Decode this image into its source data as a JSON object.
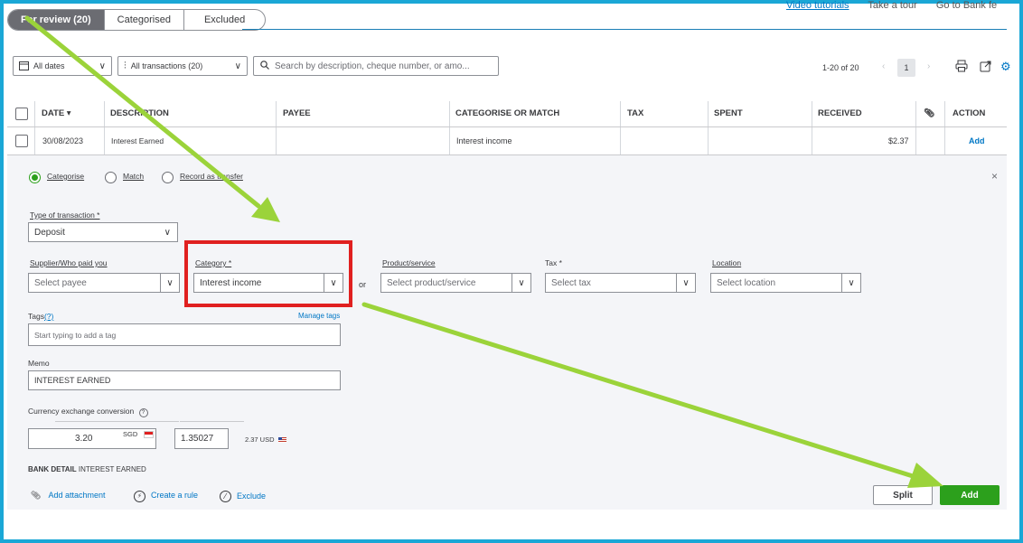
{
  "top_links": {
    "video": "Video tutorials",
    "tour": "Take a tour",
    "goto": "Go to Bank fe"
  },
  "tabs": [
    {
      "label": "For review (20)",
      "active": true
    },
    {
      "label": "Categorised",
      "active": false
    },
    {
      "label": "Excluded",
      "active": false
    }
  ],
  "filters": {
    "dates": "All dates",
    "transactions": "All transactions (20)",
    "search_placeholder": "Search by description, cheque number, or amo..."
  },
  "pager": {
    "range": "1-20 of 20",
    "page": "1"
  },
  "table": {
    "headers": {
      "date": "DATE",
      "description": "DESCRIPTION",
      "payee": "PAYEE",
      "category": "CATEGORISE OR MATCH",
      "tax": "TAX",
      "spent": "SPENT",
      "received": "RECEIVED",
      "action": "ACTION"
    },
    "row": {
      "date": "30/08/2023",
      "description": "Interest Earned",
      "payee": "",
      "category": "Interest income",
      "tax": "",
      "spent": "",
      "received": "$2.37",
      "action": "Add"
    }
  },
  "panel": {
    "modes": {
      "categorise": "Categorise",
      "match": "Match",
      "transfer": "Record as transfer"
    },
    "type_label": "Type of transaction *",
    "type_value": "Deposit",
    "supplier_label": "Supplier/Who paid you",
    "supplier_placeholder": "Select payee",
    "category_label": "Category *",
    "category_value": "Interest income",
    "or_text": "or",
    "product_label": "Product/service",
    "product_placeholder": "Select product/service",
    "tax_label": "Tax *",
    "tax_placeholder": "Select tax",
    "location_label": "Location",
    "location_placeholder": "Select location",
    "tags_label": "Tags",
    "tags_help": "(?)",
    "manage_tags": "Manage tags",
    "tags_placeholder": "Start typing to add a tag",
    "memo_label": "Memo",
    "memo_value": "INTEREST EARNED",
    "currency_label": "Currency exchange conversion",
    "amount_value": "3.20",
    "currency_code": "SGD",
    "rate_value": "1.35027",
    "converted_value": "2.37 USD",
    "bank_detail_label": "BANK DETAIL",
    "bank_detail_value": "INTEREST EARNED",
    "add_attachment": "Add attachment",
    "create_rule": "Create a rule",
    "exclude": "Exclude",
    "split_button": "Split",
    "add_button": "Add"
  },
  "colors": {
    "accent_green": "#2ca01c",
    "link_blue": "#0077c5",
    "annotation_red": "#e02020",
    "arrow_green": "#9bd33a",
    "frame_blue": "#1aa7d6"
  }
}
